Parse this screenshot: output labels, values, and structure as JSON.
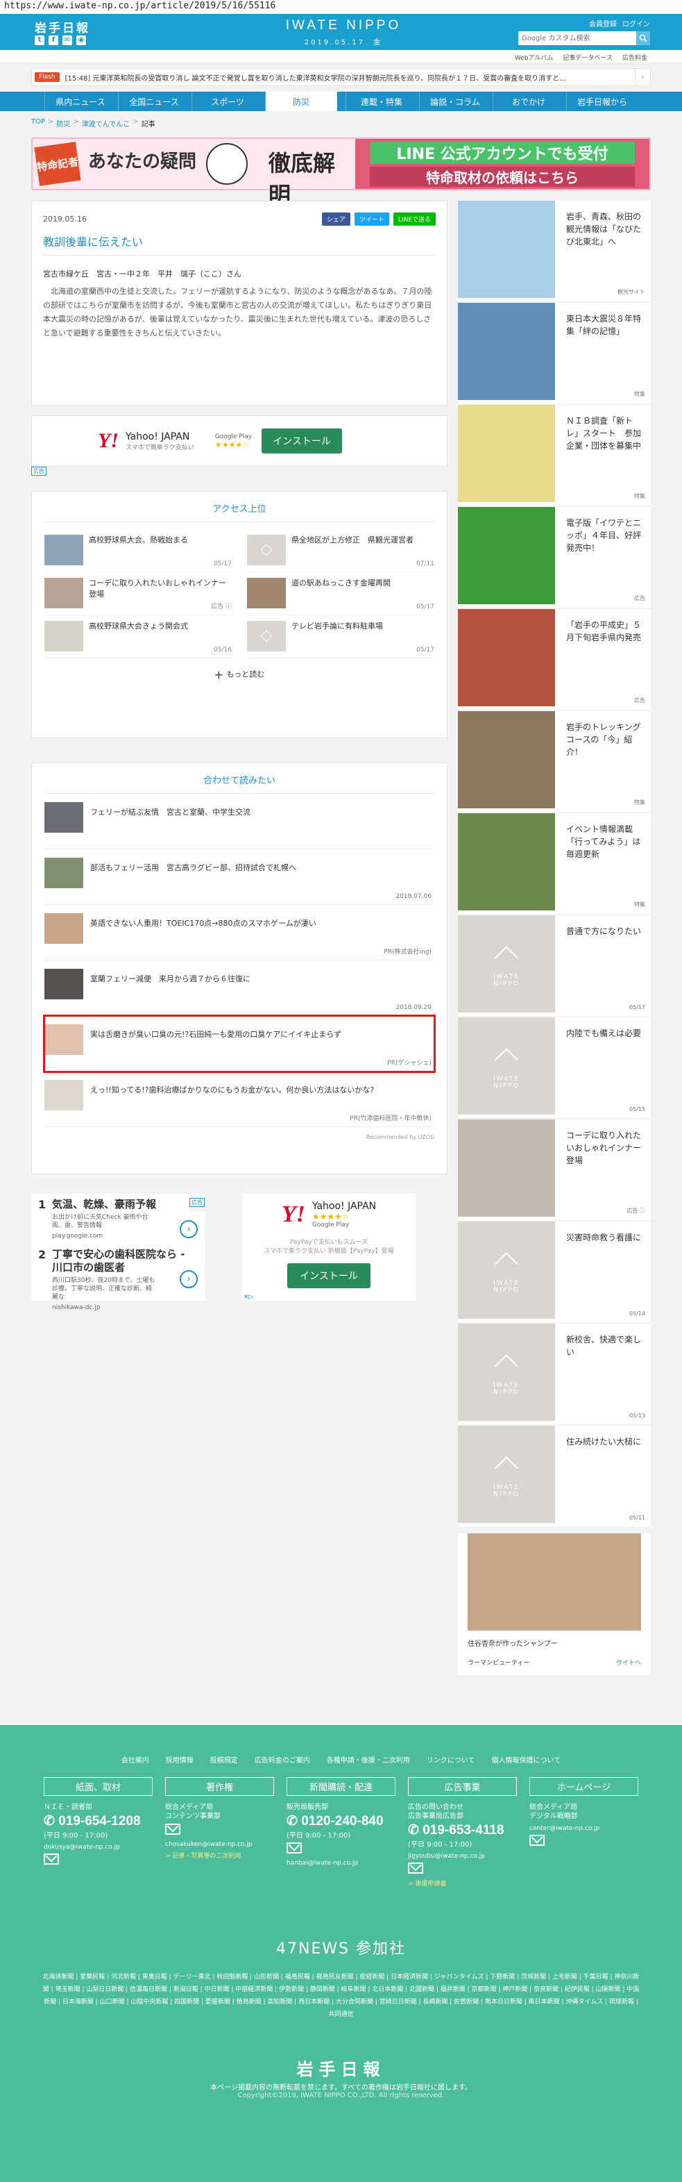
{
  "browser": {
    "url": "https://www.iwate-np.co.jp/article/2019/5/16/55116"
  },
  "header": {
    "logo": "岩手日報",
    "masthead": "IWATE NIPPO",
    "date": "2019.05.17. 金",
    "links": [
      "会員登録",
      "ログイン"
    ],
    "search_placeholder": "Google カスタム検索",
    "sublinks": [
      "Webアルバム",
      "記事データベース",
      "広告料金"
    ]
  },
  "flash": {
    "tag": "Flash",
    "text": "[15:48] 元東洋英和院長の受賞取り消し 論文不正で発覚し賞を取り消した東洋英和女学院の深井智朗元院長を巡り、同院長が１７日、受賞の審査を取り消すと…"
  },
  "nav": [
    "県内ニュース",
    "全国ニュース",
    "スポーツ",
    "防災",
    "連載・特集",
    "論説・コラム",
    "おでかけ",
    "岩手日報から"
  ],
  "nav_active": "防災",
  "breadcrumb": [
    "TOP",
    "防災",
    "津波てんでんこ",
    "記事"
  ],
  "banner": {
    "badge": "特命記者",
    "title1": "あなたの",
    "title2": "疑問",
    "title3": "徹底解明",
    "line1": "LINE 公式アカウントでも受付",
    "line2": "特命取材の依頼はこちら"
  },
  "article": {
    "date": "2019.05.16",
    "share": [
      "シェア",
      "ツイート",
      "LINEで送る"
    ],
    "title": "教訓後輩に伝えたい",
    "author": "宮古市緑ケ丘　宮古・一中２年　平井　瑞子（ここ）さん",
    "body": "北海道の室蘭西中の生徒と交流した。フェリーが運航するようになり、防災のような概念があるなあ。７月の陸の部研ではこちらが室蘭市を訪問するが、今後も室蘭市と宮古の人の交流が増えてほしい。私たちはぎりぎり東日本大震災の時の記憶があるが、後輩は覚えていなかったり、震災後に生まれた世代も増えている。津波の恐ろしさと急いで避難する重要性をきちんと伝えていきたい。"
  },
  "ad1": {
    "brand": "Y!",
    "name": "Yahoo! JAPAN",
    "sub": "スマホで簡単ラク支払い",
    "gp": "Google Play",
    "stars": "★★★★☆",
    "install": "インストール",
    "tag": "広告"
  },
  "ranking": {
    "title": "アクセス上位",
    "items": [
      {
        "title": "高校野球県大会、熱戦始まる",
        "date": "05/17"
      },
      {
        "title": "県全地区が上方修正　県観光運営者",
        "date": "07/11"
      },
      {
        "title": "コーデに取り入れたいおしゃれインナー登場",
        "date": "広告 ⓘ"
      },
      {
        "title": "道の駅あねっこきす金曜再開",
        "date": "05/17"
      },
      {
        "title": "高校野球県大会きょう開会式",
        "date": "05/16"
      },
      {
        "title": "テレビ岩手論に有料駐車場",
        "date": "05/17"
      }
    ],
    "more": "もっと読む"
  },
  "recommend": {
    "title": "合わせて読みたい",
    "items": [
      {
        "title": "フェリーが結ぶ友情　宮古と室蘭、中学生交流",
        "date": ""
      },
      {
        "title": "部活もフェリー活用　宮古高ラグビー部、招待試合で札幌へ",
        "date": "2018.07.06"
      },
      {
        "title": "英語できない人重用！TOEIC170点→880点のスマホゲームが凄い",
        "date": "PR(株式会社ing)"
      },
      {
        "title": "室蘭フェリー減便　来月から週７から６往復に",
        "date": "2018.09.29"
      },
      {
        "title": "実は舌磨きが臭い口臭の元!?石田純一も愛用の口臭ケアにイイキ止まらず",
        "date": "PR(ゲシャシェ)"
      },
      {
        "title": "えっ!!知ってる!?歯科治療ばかりなのにもうお金がない。何か良い方法はないかな?",
        "date": "PR(竹添歯科医院・年中無休)"
      }
    ],
    "footer": "Recommended by UZOU"
  },
  "ad_list": {
    "tag": "広告",
    "items": [
      {
        "num": "1",
        "title": "気温、乾燥、豪雨予報",
        "sub": "お出かけ前に天気Check 豪雨や台風、雷、警告情報",
        "src": "play.google.com"
      },
      {
        "num": "2",
        "title": "丁寧で安心の歯科医院なら - 川口市の歯医者",
        "sub": "西川口駅30秒、夜20時まで。土曜も診療。丁寧な説明、正確な診断、綺麗な",
        "src": "nishikawa-dc.jp"
      }
    ]
  },
  "ad_yahoo": {
    "brand": "Y!",
    "name": "Yahoo! JAPAN",
    "stars": "★★★★☆",
    "gp": "Google Play",
    "desc1": "PayPayで支払いもスムーズ",
    "desc2": "スマホで楽ラク支払い 新機能【PayPay】登場",
    "install": "インストール",
    "x": "✕▷"
  },
  "sidebar": {
    "items": [
      {
        "title": "岩手、青森、秋田の観光情報は「なびたび北東北」へ",
        "date": "観光サイト"
      },
      {
        "title": "東日本大震災８年特集「絆の記憶」",
        "date": "特集"
      },
      {
        "title": "ＮＩＢ調査「新トレ」スタート　参加企業・団体を募集中",
        "date": "特集"
      },
      {
        "title": "電子版「イワテとニッポ」４年目、好評発売中！",
        "date": "広告"
      },
      {
        "title": "「岩手の平成史」５月下旬岩手県内発売",
        "date": "広告"
      },
      {
        "title": "岩手のトレッキングコースの「今」紹介！",
        "date": "特集"
      },
      {
        "title": "イベント情報満載「行ってみよう」は毎週更新",
        "date": "特集"
      },
      {
        "title": "普通で方になりたい",
        "date": "05/17"
      },
      {
        "title": "内陸でも備えは必要",
        "date": "05/15"
      },
      {
        "title": "コーデに取り入れたいおしゃれインナー登場",
        "date": "広告 ⓘ"
      },
      {
        "title": "災害時命救う看護に",
        "date": "05/14"
      },
      {
        "title": "新校舎、快適で楽しい",
        "date": "05/13"
      },
      {
        "title": "住み続けたい大槌に",
        "date": "05/11"
      }
    ],
    "ad": {
      "title": "住谷杏奈が作ったシャンプー",
      "brand": "ラーマンビューティー",
      "link": "サイトへ"
    }
  },
  "footer": {
    "links": [
      "会社案内",
      "採用情報",
      "投稿規定",
      "広告料金のご案内",
      "各種申請・後援・二次利用",
      "リンクについて",
      "個人情報保護について"
    ],
    "cols": [
      {
        "head": "紙面、取材",
        "label": "ＮＩＥ・読者部",
        "phone": "019-654-1208",
        "hours": "(平日 9:00 - 17:00)",
        "mail": "dokusya@iwate-np.co.jp",
        "link": ""
      },
      {
        "head": "著作権",
        "label": "総合メディア局\nコンテンツ事業部",
        "phone": "",
        "hours": "",
        "mail": "chosakuken@iwate-np.co.jp",
        "link": "> 記事・写真等の二次利用"
      },
      {
        "head": "新聞購読・配達",
        "label": "販売局販売部",
        "phone": "0120-240-840",
        "hours": "(平日 9:00 - 17:00)",
        "mail": "hanbai@iwate-np.co.jp",
        "link": ""
      },
      {
        "head": "広告事業",
        "label": "広告の問い合わせ\n広告事業局広告部",
        "phone": "019-653-4118",
        "hours": "(平日 9:00 - 17:00)",
        "mail": "jigyoubu@iwate-np.co.jp",
        "link": "> 後援申請書"
      },
      {
        "head": "ホームページ",
        "label": "総合メディア局\nデジタル戦略部",
        "phone": "",
        "hours": "",
        "mail": "center@iwate-np.co.jp",
        "link": ""
      }
    ],
    "news47": "47NEWS 参加社",
    "papers": "北海道新聞 | 室蘭民報 | 河北新報 | 東奥日報 | デーリー東北 | 秋田魁新報 | 山形新聞 | 福島民報 | 福島民友新聞 | 産経新聞 | 日本経済新聞 | ジャパンタイムズ | 下野新聞 | 茨城新聞 | 上毛新聞 | 千葉日報 | 神奈川新聞 | 埼玉新聞 | 山梨日日新聞 | 信濃毎日新聞 | 新潟日報 | 中日新聞 | 中部経済新聞 | 伊勢新聞 | 静岡新聞 | 岐阜新聞 | 北日本新聞 | 北國新聞 | 福井新聞 | 京都新聞 | 神戸新聞 | 奈良新聞 | 紀伊民報 | 山陽新聞 | 中国新聞 | 日本海新聞 | 山口新聞 | 山陰中央新報 | 四国新聞 | 愛媛新聞 | 徳島新聞 | 高知新聞 | 西日本新聞 | 大分合同新聞 | 宮崎日日新聞 | 長崎新聞 | 佐賀新聞 | 熊本日日新聞 | 南日本新聞 | 沖縄タイムス | 琉球新報 | 共同通信",
    "logo": "岩手日報",
    "note": "本ページ掲載内容の無断転載を禁じます。すべての著作権は岩手日報社に属します。",
    "copy": "Copyright©2019, IWATE NIPPO CO.,LTD. All rights reserved."
  }
}
